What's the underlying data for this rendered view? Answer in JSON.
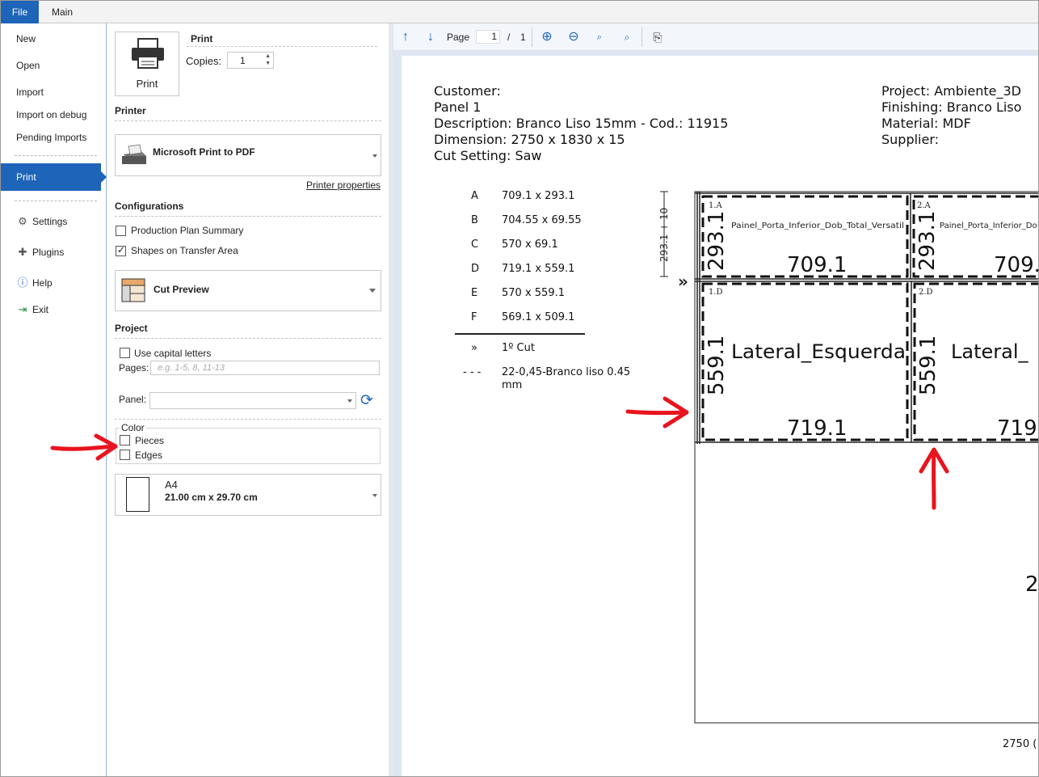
{
  "tabs": {
    "file": "File",
    "main": "Main"
  },
  "nav": {
    "new": "New",
    "open": "Open",
    "import": "Import",
    "import_debug": "Import on debug",
    "pending": "Pending Imports",
    "print": "Print",
    "settings": "Settings",
    "plugins": "Plugins",
    "help": "Help",
    "exit": "Exit"
  },
  "print_section": {
    "button_label": "Print",
    "header": "Print",
    "copies_label": "Copies:",
    "copies_value": "1"
  },
  "printer_section": {
    "header": "Printer",
    "printer_name": "Microsoft Print to PDF",
    "properties_link": "Printer properties"
  },
  "config_section": {
    "header": "Configurations",
    "production_plan_summary": {
      "label": "Production Plan Summary",
      "checked": false
    },
    "shapes_on_transfer_area": {
      "label": "Shapes on Transfer Area",
      "checked": true
    },
    "layout_selected": "Cut Preview"
  },
  "project_section": {
    "header": "Project",
    "use_capital_letters": {
      "label": "Use capital letters",
      "checked": false
    },
    "pages_label": "Pages:",
    "pages_placeholder": "e.g. 1-5, 8, 11-13",
    "panel_label": "Panel:",
    "panel_value": ""
  },
  "color_section": {
    "legend": "Color",
    "pieces": {
      "label": "Pieces",
      "checked": false
    },
    "edges": {
      "label": "Edges",
      "checked": false
    }
  },
  "paper": {
    "name": "A4",
    "size": "21.00 cm x 29.70 cm"
  },
  "preview_toolbar": {
    "page_label": "Page",
    "page_current": "1",
    "page_sep": "/",
    "page_total": "1"
  },
  "document": {
    "customer": "Customer:",
    "panel": "Panel 1",
    "description": "Description: Branco Liso 15mm - Cod.: 11915",
    "dimension": "Dimension: 2750 x 1830 x 15",
    "cut_setting": "Cut Setting: Saw",
    "project": "Project: Ambiente_3D",
    "finishing": "Finishing: Branco Liso",
    "material": "Material: MDF",
    "supplier": "Supplier:",
    "legend": [
      {
        "key": "A",
        "value": "709.1 x 293.1"
      },
      {
        "key": "B",
        "value": "704.55 x 69.55"
      },
      {
        "key": "C",
        "value": "570 x 69.1"
      },
      {
        "key": "D",
        "value": "719.1 x 559.1"
      },
      {
        "key": "E",
        "value": "570 x 559.1"
      },
      {
        "key": "F",
        "value": "569.1 x 509.1"
      }
    ],
    "first_cut_symbol": "»",
    "first_cut_label": "1º Cut",
    "edge_symbol": "- - -",
    "edge_label_1": "22-0,45-Branco liso  0.45",
    "edge_label_2": "mm",
    "dim_side": "293.1 + 10",
    "bottom_dim": "2750 (",
    "right_partial": "2",
    "pieces": [
      {
        "tag": "1.A",
        "name": "Painel_Porta_Inferior_Dob_Total_Versatil",
        "width": "709.1",
        "height": "293.1"
      },
      {
        "tag": "2.A",
        "name": "Painel_Porta_Inferior_Do",
        "width": "709.",
        "height": "293.1"
      },
      {
        "tag": "1.D",
        "name": "Lateral_Esquerda",
        "width": "719.1",
        "height": "559.1"
      },
      {
        "tag": "2.D",
        "name": "Lateral_",
        "width": "719",
        "height": "559.1"
      }
    ]
  },
  "colors": {
    "accent": "#1e64b8",
    "annotation_arrow": "#e8141e"
  }
}
